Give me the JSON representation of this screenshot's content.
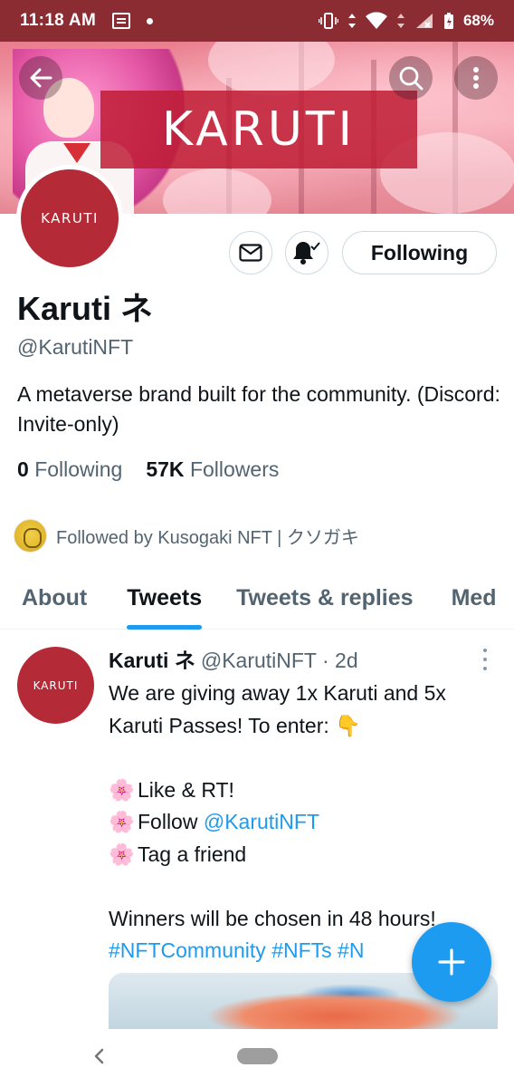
{
  "status_bar": {
    "time": "11:18 AM",
    "battery": "68%"
  },
  "banner": {
    "title": "KARUTI"
  },
  "profile": {
    "avatar_text": "KARUTI",
    "name": "Karuti ネ",
    "handle": "@KarutiNFT",
    "bio": "A metaverse brand built for the community. (Discord: Invite-only)",
    "following_count": "0",
    "following_label": "Following",
    "followers_count": "57K",
    "followers_label": "Followers",
    "followed_by": "Followed by Kusogaki NFT | クソガキ",
    "follow_button": "Following"
  },
  "tabs": [
    {
      "label": "About",
      "active": false
    },
    {
      "label": "Tweets",
      "active": true
    },
    {
      "label": "Tweets & replies",
      "active": false
    },
    {
      "label": "Med",
      "active": false
    }
  ],
  "tweet": {
    "avatar_text": "KARUTI",
    "name": "Karuti ネ",
    "handle": "@KarutiNFT",
    "time": "· 2d",
    "line1": "We are giving away 1x Karuti and 5x Karuti Passes! To enter:",
    "emoji_point": "👇",
    "emoji_blossom": "🌸",
    "item1": "Like & RT!",
    "item2_prefix": "Follow",
    "item2_link": "@KarutiNFT",
    "item3": "Tag a friend",
    "closing": "Winners will be chosen in 48 hours!",
    "hashtags": "#NFTCommunity #NFTs #N"
  },
  "colors": {
    "accent": "#1d9bf0",
    "brand": "#b52a37",
    "status_bar": "#8b2b32"
  }
}
